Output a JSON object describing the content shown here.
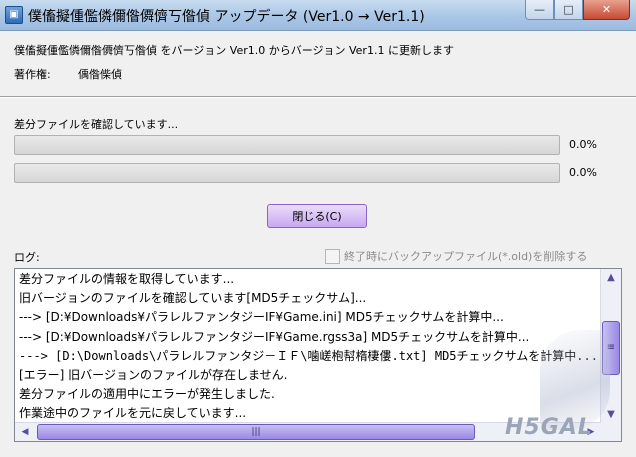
{
  "window": {
    "title": "僕傗擬偅儖僯儞偺僲儕丂偺偵 アップデータ (Ver1.0 → Ver1.1)",
    "buttons": {
      "minimize": "—",
      "maximize": "□",
      "close": "✕"
    }
  },
  "info": {
    "message": "僕傗擬偅儖僯儞偺僲儕丂偺偵 をバージョン Ver1.0 からバージョン Ver1.1 に更新します",
    "author_label": "著作権:",
    "author_value": "偊偺偨偵"
  },
  "status": {
    "text": "差分ファイルを確認しています...",
    "progress": [
      {
        "value": 0.0,
        "label": "0.0%"
      },
      {
        "value": 0.0,
        "label": "0.0%"
      }
    ]
  },
  "close_button": {
    "label": "閉じる(C)"
  },
  "log": {
    "label": "ログ:",
    "backup_checkbox_label": "終了時にバックアップファイル(*.old)を削除する",
    "backup_checked": false,
    "lines": [
      "差分ファイルの情報を取得しています...",
      "旧バージョンのファイルを確認しています[MD5チェックサム]...",
      "    ---> [D:¥Downloads¥パラレルファンタジーIF¥Game.ini] MD5チェックサムを計算中...",
      "    ---> [D:¥Downloads¥パラレルファンタジーIF¥Game.rgss3a] MD5チェックサムを計算中...",
      "    ---> [D:\\Downloads\\パラレルファンタジ－ＩＦ\\噛嵯枹幇楕棲僂.txt] MD5チェックサムを計算中...",
      "[エラー] 旧バージョンのファイルが存在しません.",
      "差分ファイルの適用中にエラーが発生しました.",
      "作業途中のファイルを元に戻しています..."
    ]
  },
  "icons": {
    "app": "app-icon",
    "scroll_up": "▲",
    "scroll_down": "▼",
    "scroll_left": "◀",
    "scroll_right": "▶",
    "grip_v": "≡",
    "grip_h": "|||"
  },
  "watermark": {
    "text": "H5GAL"
  },
  "colors": {
    "progress_fill": "#57c757",
    "button_accent": "#c6a8f0"
  }
}
